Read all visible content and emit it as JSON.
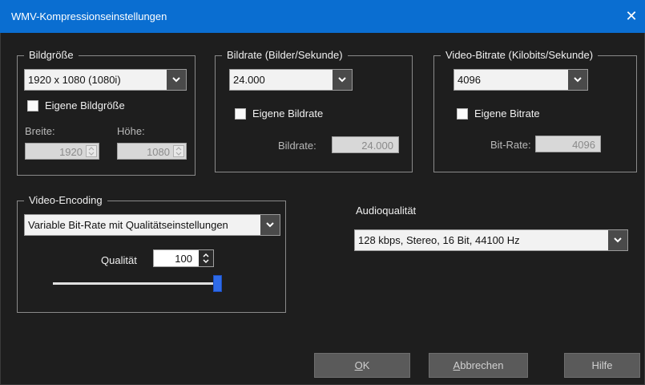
{
  "window": {
    "title": "WMV-Kompressionseinstellungen",
    "close_glyph": "✕"
  },
  "frame_size": {
    "legend": "Bildgröße",
    "select_value": "1920 x 1080 (1080i)",
    "custom_label": "Eigene Bildgröße",
    "custom_checked": false,
    "width_label": "Breite:",
    "height_label": "Höhe:",
    "width_value": "1920",
    "height_value": "1080"
  },
  "frame_rate": {
    "legend": "Bildrate (Bilder/Sekunde)",
    "select_value": "24.000",
    "custom_label": "Eigene Bildrate",
    "custom_checked": false,
    "field_label": "Bildrate:",
    "field_value": "24.000"
  },
  "video_bitrate": {
    "legend": "Video-Bitrate (Kilobits/Sekunde)",
    "select_value": "4096",
    "custom_label": "Eigene Bitrate",
    "custom_checked": false,
    "field_label": "Bit-Rate:",
    "field_value": "4096"
  },
  "video_encoding": {
    "legend": "Video-Encoding",
    "select_value": "Variable Bit-Rate mit Qualitätseinstellungen",
    "quality_label": "Qualität",
    "quality_value": "100",
    "quality_fraction": 1.0
  },
  "audio": {
    "label": "Audioqualität",
    "select_value": "128 kbps, Stereo, 16 Bit, 44100 Hz"
  },
  "buttons": {
    "ok_mnemonic": "O",
    "ok_rest": "K",
    "cancel_mnemonic": "A",
    "cancel_rest": "bbrechen",
    "help": "Hilfe"
  },
  "colors": {
    "titlebar": "#0a6ed1",
    "background": "#1e1e1e",
    "slider_thumb": "#2f6be8"
  }
}
